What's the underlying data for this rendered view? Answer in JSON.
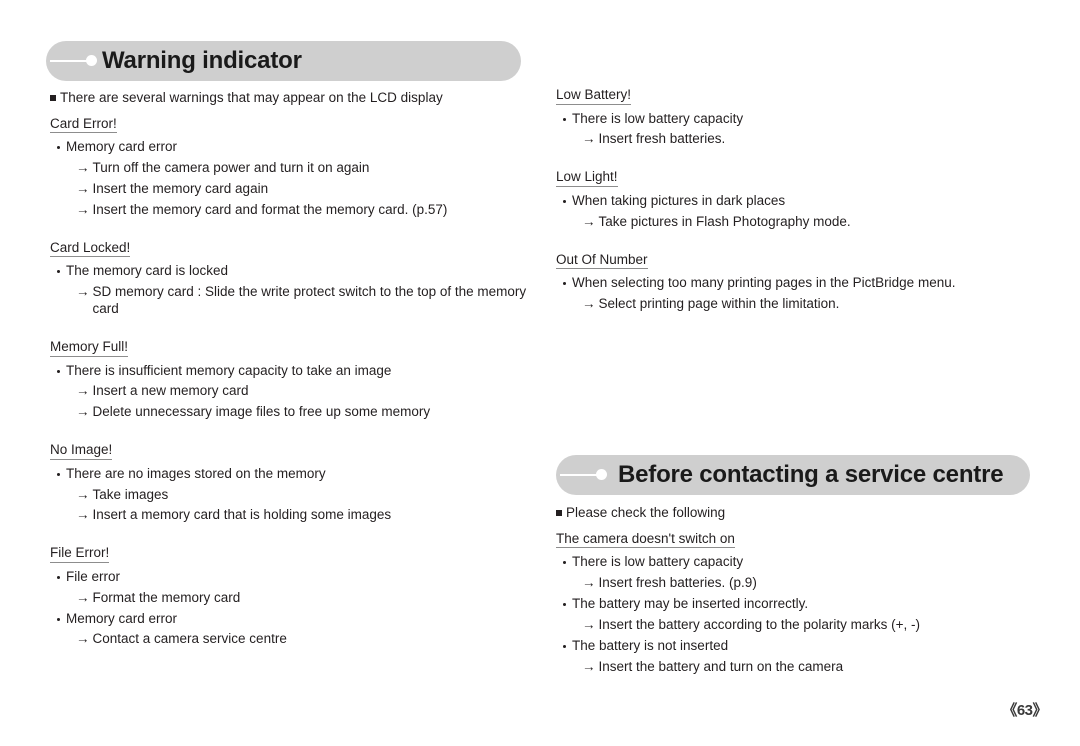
{
  "page": {
    "number_label": "《63》"
  },
  "sections": [
    {
      "banner_title": "Warning indicator",
      "intro": "There are several warnings that may appear on the LCD display",
      "groups": [
        {
          "heading": "Card Error!",
          "items": [
            {
              "kind": "bullet",
              "text": "Memory card error"
            },
            {
              "kind": "arrow",
              "text": "Turn off the camera power and turn it on again"
            },
            {
              "kind": "arrow",
              "text": "Insert the memory card again"
            },
            {
              "kind": "arrow",
              "text": "Insert the memory card and format the memory card. (p.57)"
            }
          ]
        },
        {
          "heading": "Card Locked!",
          "items": [
            {
              "kind": "bullet",
              "text": "The memory card is locked"
            },
            {
              "kind": "arrow",
              "text": "SD memory card : Slide the write protect switch to the top of the memory card"
            }
          ]
        },
        {
          "heading": "Memory Full!",
          "items": [
            {
              "kind": "bullet",
              "text": "There is insufficient memory capacity to take an image"
            },
            {
              "kind": "arrow",
              "text": "Insert a new memory card"
            },
            {
              "kind": "arrow",
              "text": "Delete unnecessary image files to free up some memory"
            }
          ]
        },
        {
          "heading": "No Image!",
          "items": [
            {
              "kind": "bullet",
              "text": "There are no images stored on the memory"
            },
            {
              "kind": "arrow",
              "text": "Take images"
            },
            {
              "kind": "arrow",
              "text": "Insert a memory card that is holding some images"
            }
          ]
        },
        {
          "heading": "File Error!",
          "items": [
            {
              "kind": "bullet",
              "text": "File error"
            },
            {
              "kind": "arrow",
              "text": "Format the memory card"
            },
            {
              "kind": "bullet",
              "text": "Memory card error"
            },
            {
              "kind": "arrow",
              "text": "Contact a camera service centre"
            }
          ]
        }
      ],
      "right_groups": [
        {
          "heading": "Low Battery!",
          "items": [
            {
              "kind": "bullet",
              "text": "There is low battery capacity"
            },
            {
              "kind": "arrow",
              "text": "Insert fresh batteries."
            }
          ]
        },
        {
          "heading": "Low Light!",
          "items": [
            {
              "kind": "bullet",
              "text": "When taking pictures in dark places"
            },
            {
              "kind": "arrow",
              "text": "Take pictures in Flash Photography mode."
            }
          ]
        },
        {
          "heading": "Out Of Number",
          "items": [
            {
              "kind": "bullet",
              "text": "When selecting too many printing pages in the PictBridge menu."
            },
            {
              "kind": "arrow",
              "text": "Select printing page within the limitation."
            }
          ]
        }
      ]
    },
    {
      "banner_title": "Before contacting a service centre",
      "intro": "Please check the following",
      "groups": [
        {
          "heading": "The camera doesn't switch on",
          "items": [
            {
              "kind": "bullet",
              "text": "There is low battery capacity"
            },
            {
              "kind": "arrow",
              "text": "Insert fresh batteries. (p.9)"
            },
            {
              "kind": "bullet",
              "text": "The battery may be inserted incorrectly."
            },
            {
              "kind": "arrow",
              "text": "Insert the battery according to the polarity marks (+, -)"
            },
            {
              "kind": "bullet",
              "text": "The battery is not inserted"
            },
            {
              "kind": "arrow",
              "text": "Insert the battery and turn on the camera"
            }
          ]
        }
      ]
    }
  ],
  "icons": {
    "arrow_glyph": "→",
    "banner_knob": "banner-knob-icon"
  },
  "colors": {
    "banner_bg": "#cfcfcf",
    "text": "#231f20",
    "heading_rule": "#8d8d8d"
  }
}
